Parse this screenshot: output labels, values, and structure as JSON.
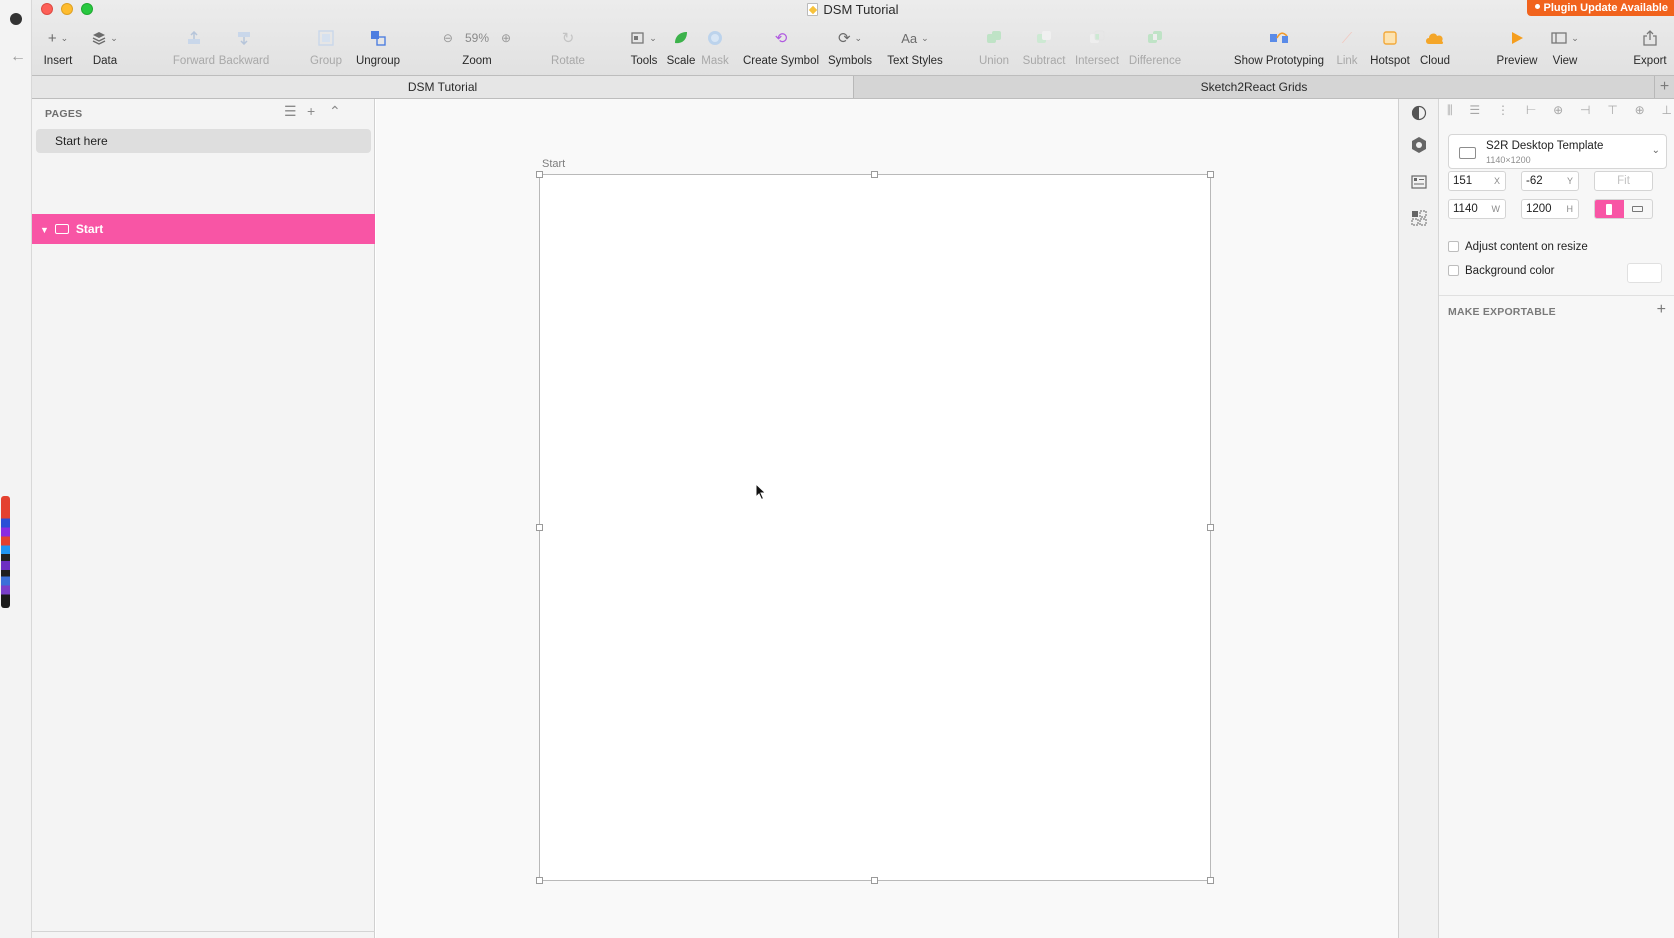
{
  "window": {
    "title": "DSM Tutorial",
    "plugin_badge": "Plugin Update Available"
  },
  "toolbar": {
    "insert": "Insert",
    "data": "Data",
    "forward": "Forward",
    "backward": "Backward",
    "group": "Group",
    "ungroup": "Ungroup",
    "zoom": "Zoom",
    "zoom_value": "59%",
    "rotate": "Rotate",
    "tools": "Tools",
    "scale": "Scale",
    "mask": "Mask",
    "create_symbol": "Create Symbol",
    "symbols": "Symbols",
    "text_styles": "Text Styles",
    "union": "Union",
    "subtract": "Subtract",
    "intersect": "Intersect",
    "difference": "Difference",
    "show_prototyping": "Show Prototyping",
    "link": "Link",
    "hotspot": "Hotspot",
    "cloud": "Cloud",
    "preview": "Preview",
    "view": "View",
    "export": "Export"
  },
  "tabs": [
    {
      "label": "DSM Tutorial",
      "active": true
    },
    {
      "label": "Sketch2React Grids",
      "active": false
    }
  ],
  "pages_panel": {
    "header": "PAGES",
    "pages": [
      "Start here"
    ],
    "layers": [
      {
        "name": "Start",
        "selected": true
      }
    ]
  },
  "canvas": {
    "artboard_name": "Start"
  },
  "inspector": {
    "preset_name": "S2R Desktop Template",
    "preset_size": "1140×1200",
    "x": "151",
    "y": "-62",
    "w": "1140",
    "h": "1200",
    "x_label": "X",
    "y_label": "Y",
    "w_label": "W",
    "h_label": "H",
    "fit_label": "Fit",
    "adjust_content": "Adjust content on resize",
    "background_color": "Background color",
    "make_exportable": "MAKE EXPORTABLE"
  },
  "colors": {
    "selection_pink": "#f855a5",
    "plugin_badge": "#f1631d"
  }
}
